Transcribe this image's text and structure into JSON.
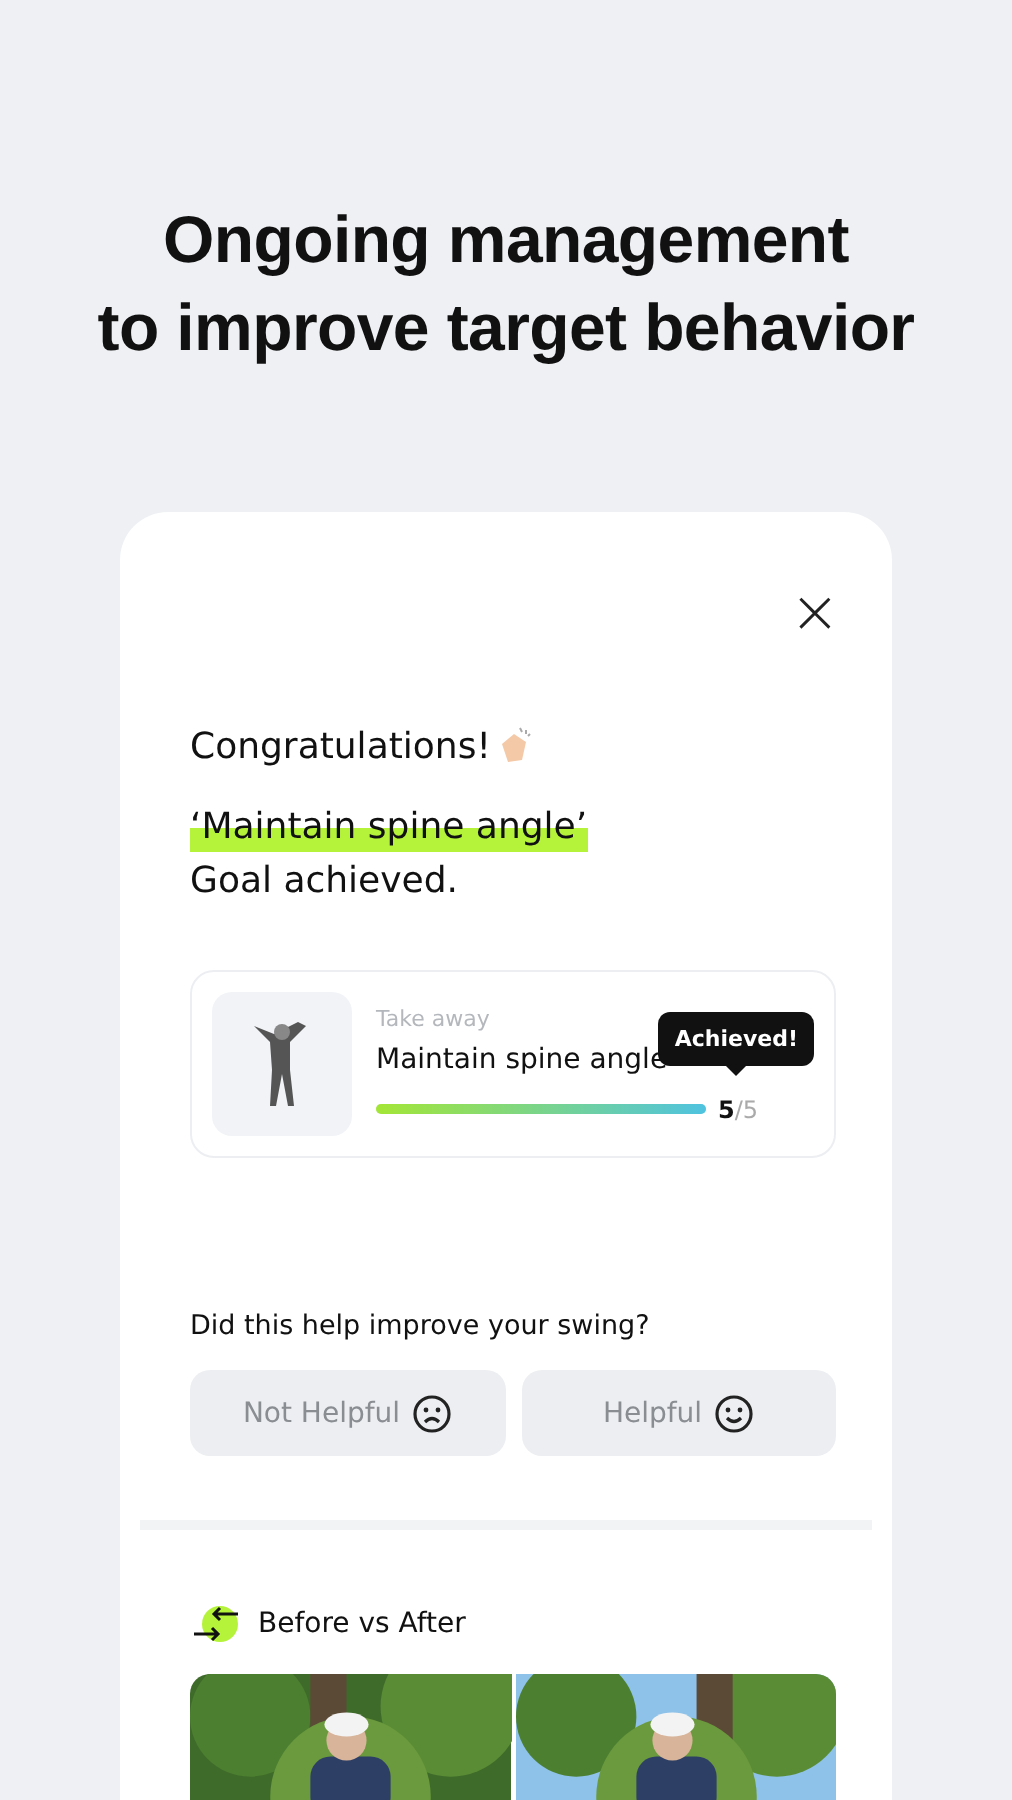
{
  "headline": [
    "Ongoing management",
    "to improve target behavior"
  ],
  "dialog": {
    "close": "×",
    "congrats": "Congratulations!",
    "goal_highlight": "‘Maintain spine angle’",
    "goal_text": "Goal achieved.",
    "goal_card": {
      "category": "Take away",
      "title": "Maintain spine angle",
      "level": 1,
      "count": "**5**/5",
      "badge": "Achieved!"
    },
    "question": "Did this help improve your swing?",
    "feedback": [
      {
        "label": "Not Helpful",
        "kind": "sad",
        "selected": false
      },
      {
        "label": "Helpful",
        "kind": "happy",
        "selected": false
      }
    ],
    "section_title": "Before vs After"
  }
}
